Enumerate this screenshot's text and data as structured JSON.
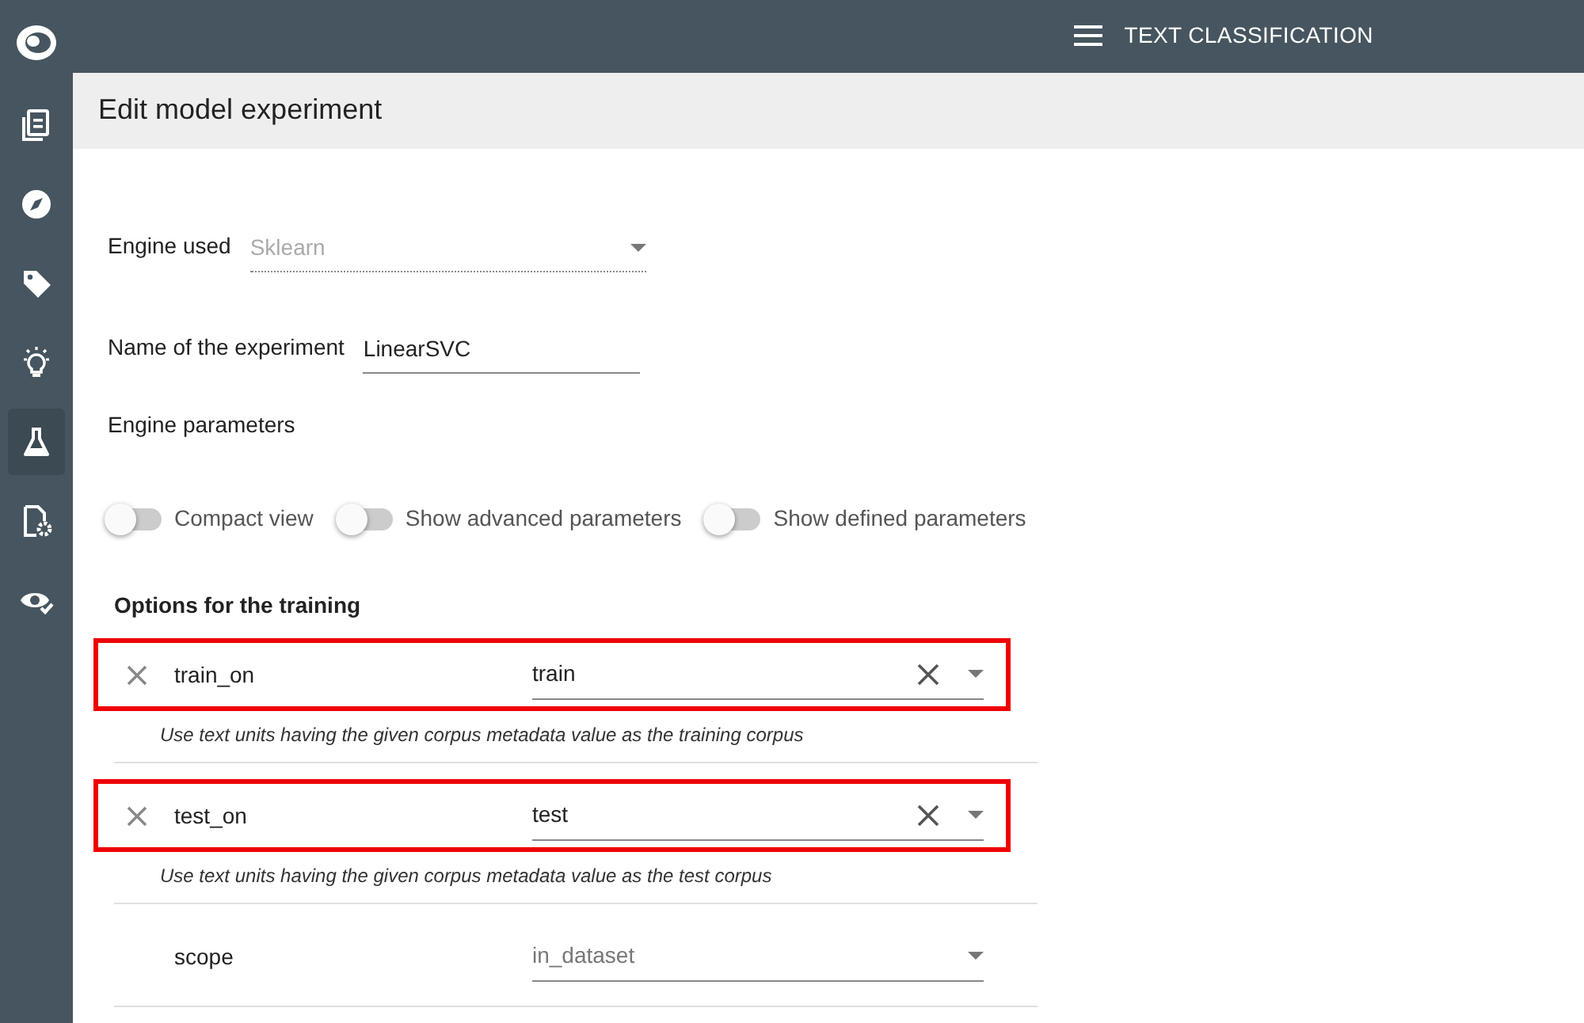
{
  "header": {
    "title": "TEXT CLASSIFICATION"
  },
  "sidebar": {
    "items": [
      {
        "kind": "documents",
        "selected": false
      },
      {
        "kind": "compass",
        "selected": false
      },
      {
        "kind": "tag",
        "selected": false
      },
      {
        "kind": "bulb",
        "selected": false
      },
      {
        "kind": "flask",
        "selected": true
      },
      {
        "kind": "file-gear",
        "selected": false
      },
      {
        "kind": "eye-check",
        "selected": false
      }
    ]
  },
  "page_title": "Edit model experiment",
  "engine": {
    "label": "Engine used",
    "value": "Sklearn",
    "disabled": true
  },
  "experiment_name": {
    "label": "Name of the experiment",
    "value": "LinearSVC"
  },
  "engine_parameters_label": "Engine parameters",
  "toggles": [
    {
      "label": "Compact view",
      "on": false
    },
    {
      "label": "Show advanced parameters",
      "on": false
    },
    {
      "label": "Show defined parameters",
      "on": false
    }
  ],
  "section_title": "Options for the training",
  "parameters": [
    {
      "name": "train_on",
      "value": "train",
      "defined": true,
      "highlighted": true,
      "description": "Use text units having the given corpus metadata value as the training corpus"
    },
    {
      "name": "test_on",
      "value": "test",
      "defined": true,
      "highlighted": true,
      "description": "Use text units having the given corpus metadata value as the test corpus"
    },
    {
      "name": "scope",
      "value": "in_dataset",
      "defined": false,
      "highlighted": false
    }
  ]
}
